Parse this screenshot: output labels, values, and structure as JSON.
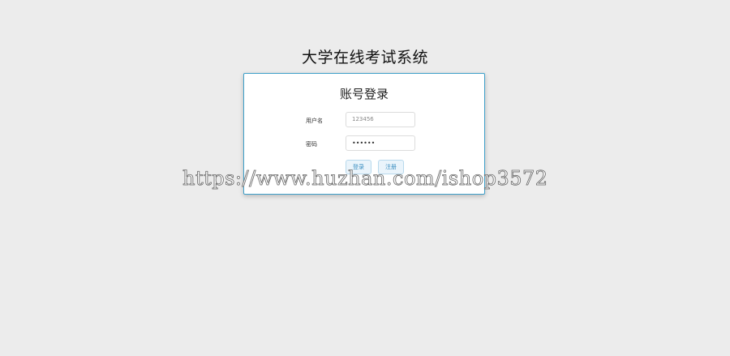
{
  "app": {
    "title": "大学在线考试系统"
  },
  "login": {
    "title": "账号登录",
    "username_label": "用户名",
    "username_value": "123456",
    "password_label": "密码",
    "password_value": "••••••",
    "login_button": "登录",
    "register_button": "注册"
  },
  "watermark": {
    "text": "https://www.huzhan.com/ishop3572"
  },
  "colors": {
    "background": "#ececec",
    "card_border": "#3d9fc9",
    "button_text": "#3a8ec0",
    "button_bg": "#eaf4fb"
  }
}
